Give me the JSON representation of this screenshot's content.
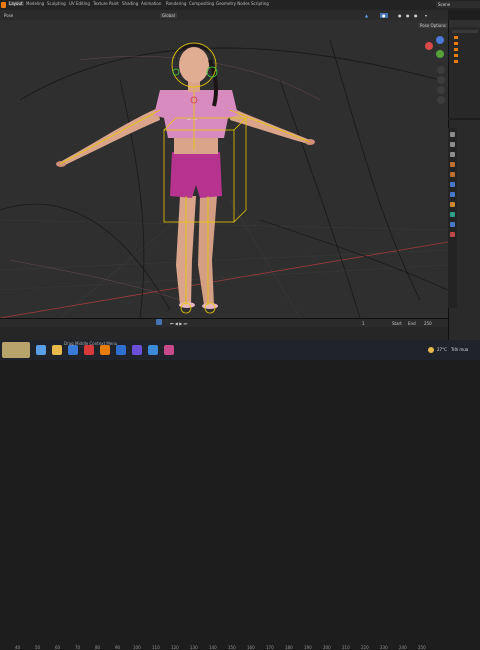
{
  "workspace_tabs": [
    "Layout",
    "Modeling",
    "Sculpting",
    "UV Editing",
    "Texture Paint",
    "Shading",
    "Animation",
    "Rendering",
    "Compositing",
    "Geometry Nodes",
    "Scripting"
  ],
  "scene_label": "Scene",
  "header": {
    "mode": "Pose",
    "orientation": "Global",
    "options": "Pose Options"
  },
  "timeline": {
    "ticks": [
      "40",
      "50",
      "60",
      "70",
      "80",
      "90",
      "100",
      "110",
      "120",
      "130",
      "140",
      "150",
      "160",
      "170",
      "180",
      "190",
      "200",
      "210",
      "220",
      "230",
      "240",
      "250"
    ],
    "start_label": "Start",
    "start_value": "1",
    "end_label": "End",
    "end_value": "250",
    "current_frame": "1"
  },
  "taskbar": {
    "weather_temp": "27°C",
    "weather_text": "Trời mưa",
    "notification": "Drag Middle Context Menu"
  },
  "colors": {
    "accent": "#4772b3",
    "armature": "#e6c800",
    "shirt": "#d88bbf",
    "shorts": "#b6338f"
  },
  "icons": [
    "blender-logo-icon",
    "camera-icon",
    "lamp-icon",
    "hand-icon",
    "zoom-icon",
    "search-icon",
    "windows-icon"
  ]
}
